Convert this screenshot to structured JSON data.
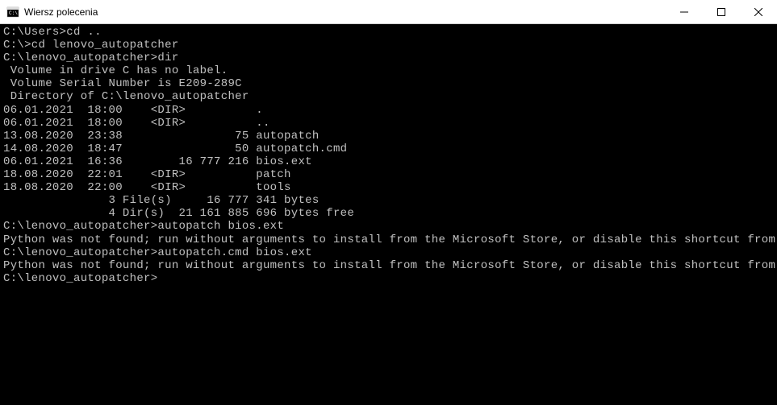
{
  "titlebar": {
    "title": "Wiersz polecenia"
  },
  "terminal": {
    "lines": [
      "C:\\Users>cd ..",
      "",
      "C:\\>cd lenovo_autopatcher",
      "",
      "C:\\lenovo_autopatcher>dir",
      " Volume in drive C has no label.",
      " Volume Serial Number is E209-289C",
      "",
      " Directory of C:\\lenovo_autopatcher",
      "",
      "06.01.2021  18:00    <DIR>          .",
      "06.01.2021  18:00    <DIR>          ..",
      "13.08.2020  23:38                75 autopatch",
      "14.08.2020  18:47                50 autopatch.cmd",
      "06.01.2021  16:36        16 777 216 bios.ext",
      "18.08.2020  22:01    <DIR>          patch",
      "18.08.2020  22:00    <DIR>          tools",
      "               3 File(s)     16 777 341 bytes",
      "               4 Dir(s)  21 161 885 696 bytes free",
      "",
      "C:\\lenovo_autopatcher>autopatch bios.ext",
      "Python was not found; run without arguments to install from the Microsoft Store, or disable this shortcut from Settings > Manage App Execution Aliases.",
      "",
      "C:\\lenovo_autopatcher>autopatch.cmd bios.ext",
      "Python was not found; run without arguments to install from the Microsoft Store, or disable this shortcut from Settings > Manage App Execution Aliases.",
      "",
      "C:\\lenovo_autopatcher>"
    ]
  }
}
